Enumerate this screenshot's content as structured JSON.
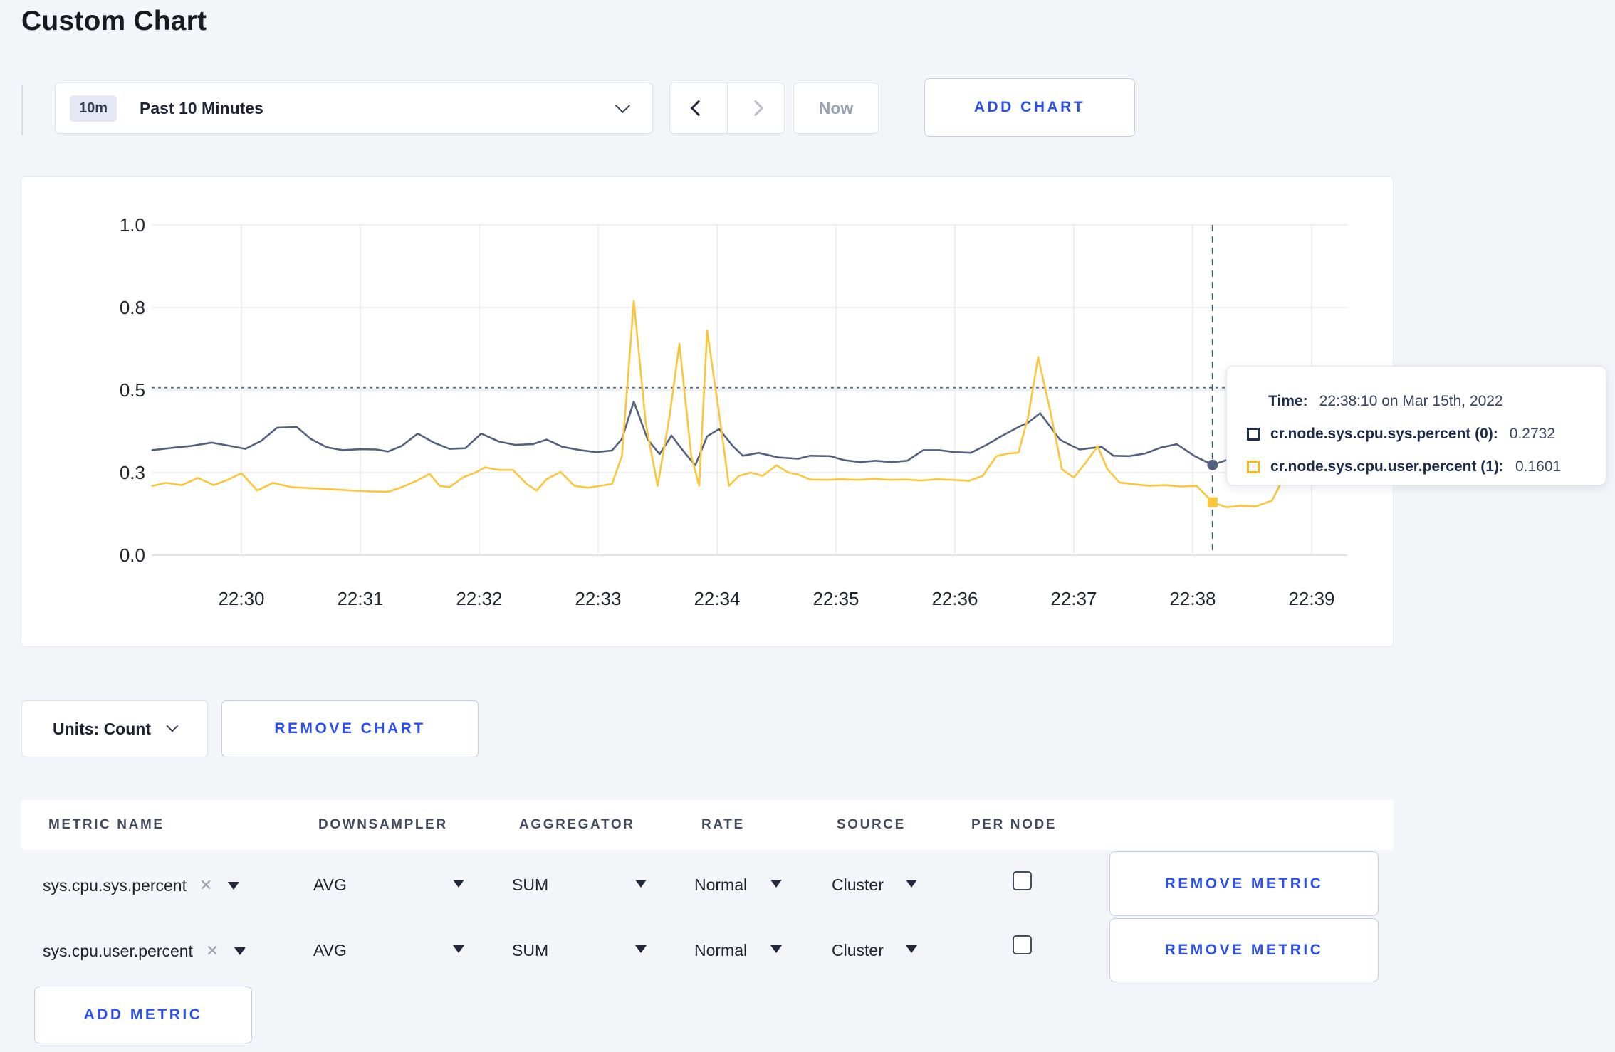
{
  "page": {
    "title": "Custom Chart",
    "background": "#f4f5f9",
    "accent_blue": "#2b4ff0"
  },
  "toolbar": {
    "time_badge": "10m",
    "time_label": "Past 10 Minutes",
    "now_label": "Now",
    "add_chart_label": "ADD CHART"
  },
  "chart_data": {
    "type": "line",
    "title": "",
    "xlabel": "",
    "ylabel": "",
    "x_domain_note": "t = seconds after 22:29:00, Mar 15th 2022",
    "ylim": [
      0,
      1
    ],
    "grid": true,
    "legend_position": "none",
    "x_ticks": [
      {
        "t": 60,
        "label": "22:30"
      },
      {
        "t": 120,
        "label": "22:31"
      },
      {
        "t": 180,
        "label": "22:32"
      },
      {
        "t": 240,
        "label": "22:33"
      },
      {
        "t": 300,
        "label": "22:34"
      },
      {
        "t": 360,
        "label": "22:35"
      },
      {
        "t": 420,
        "label": "22:36"
      },
      {
        "t": 480,
        "label": "22:37"
      },
      {
        "t": 540,
        "label": "22:38"
      },
      {
        "t": 600,
        "label": "22:39"
      }
    ],
    "y_ticks": [
      {
        "v": 0,
        "label": "0.0"
      },
      {
        "v": 0.25,
        "label": "0.3"
      },
      {
        "v": 0.5,
        "label": "0.5"
      },
      {
        "v": 0.75,
        "label": "0.8"
      },
      {
        "v": 1,
        "label": "1.0"
      }
    ],
    "series": [
      {
        "name": "cr.node.sys.cpu.sys.percent (0)",
        "color": "#54617e",
        "points": [
          [
            15,
            0.318
          ],
          [
            25,
            0.325
          ],
          [
            35,
            0.331
          ],
          [
            45,
            0.341
          ],
          [
            55,
            0.33
          ],
          [
            62,
            0.322
          ],
          [
            70,
            0.346
          ],
          [
            78,
            0.386
          ],
          [
            88,
            0.388
          ],
          [
            95,
            0.352
          ],
          [
            103,
            0.327
          ],
          [
            111,
            0.318
          ],
          [
            120,
            0.321
          ],
          [
            128,
            0.32
          ],
          [
            134,
            0.314
          ],
          [
            141,
            0.331
          ],
          [
            149,
            0.368
          ],
          [
            157,
            0.341
          ],
          [
            165,
            0.322
          ],
          [
            173,
            0.324
          ],
          [
            181,
            0.368
          ],
          [
            190,
            0.344
          ],
          [
            198,
            0.334
          ],
          [
            207,
            0.336
          ],
          [
            214,
            0.35
          ],
          [
            222,
            0.328
          ],
          [
            231,
            0.318
          ],
          [
            239,
            0.312
          ],
          [
            247,
            0.317
          ],
          [
            252,
            0.352
          ],
          [
            258,
            0.465
          ],
          [
            265,
            0.35
          ],
          [
            271,
            0.306
          ],
          [
            277,
            0.362
          ],
          [
            283,
            0.315
          ],
          [
            289,
            0.272
          ],
          [
            295,
            0.36
          ],
          [
            301,
            0.382
          ],
          [
            308,
            0.33
          ],
          [
            313,
            0.301
          ],
          [
            321,
            0.31
          ],
          [
            331,
            0.296
          ],
          [
            341,
            0.292
          ],
          [
            347,
            0.301
          ],
          [
            357,
            0.3
          ],
          [
            364,
            0.288
          ],
          [
            372,
            0.282
          ],
          [
            380,
            0.286
          ],
          [
            388,
            0.282
          ],
          [
            396,
            0.286
          ],
          [
            404,
            0.318
          ],
          [
            412,
            0.318
          ],
          [
            420,
            0.312
          ],
          [
            428,
            0.31
          ],
          [
            436,
            0.334
          ],
          [
            444,
            0.362
          ],
          [
            452,
            0.388
          ],
          [
            457,
            0.402
          ],
          [
            463,
            0.43
          ],
          [
            468,
            0.39
          ],
          [
            473,
            0.35
          ],
          [
            478,
            0.334
          ],
          [
            483,
            0.32
          ],
          [
            488,
            0.324
          ],
          [
            494,
            0.328
          ],
          [
            500,
            0.301
          ],
          [
            508,
            0.3
          ],
          [
            516,
            0.308
          ],
          [
            524,
            0.326
          ],
          [
            532,
            0.336
          ],
          [
            541,
            0.3
          ],
          [
            550,
            0.2732
          ],
          [
            558,
            0.29
          ],
          [
            566,
            0.286
          ],
          [
            575,
            0.281
          ],
          [
            584,
            0.283
          ],
          [
            593,
            0.286
          ],
          [
            602,
            0.281
          ],
          [
            611,
            0.286
          ]
        ]
      },
      {
        "name": "cr.node.sys.cpu.user.percent (1)",
        "color": "#fcc63c",
        "points": [
          [
            15,
            0.21
          ],
          [
            22,
            0.219
          ],
          [
            30,
            0.212
          ],
          [
            38,
            0.234
          ],
          [
            46,
            0.212
          ],
          [
            53,
            0.228
          ],
          [
            60,
            0.248
          ],
          [
            68,
            0.196
          ],
          [
            76,
            0.219
          ],
          [
            85,
            0.206
          ],
          [
            95,
            0.203
          ],
          [
            105,
            0.2
          ],
          [
            115,
            0.196
          ],
          [
            125,
            0.193
          ],
          [
            134,
            0.192
          ],
          [
            141,
            0.206
          ],
          [
            148,
            0.224
          ],
          [
            155,
            0.246
          ],
          [
            160,
            0.21
          ],
          [
            165,
            0.206
          ],
          [
            172,
            0.236
          ],
          [
            178,
            0.25
          ],
          [
            183,
            0.266
          ],
          [
            190,
            0.258
          ],
          [
            197,
            0.258
          ],
          [
            204,
            0.215
          ],
          [
            209,
            0.196
          ],
          [
            214,
            0.23
          ],
          [
            221,
            0.252
          ],
          [
            228,
            0.21
          ],
          [
            235,
            0.204
          ],
          [
            241,
            0.21
          ],
          [
            247,
            0.216
          ],
          [
            252,
            0.3
          ],
          [
            258,
            0.77
          ],
          [
            264,
            0.4
          ],
          [
            270,
            0.21
          ],
          [
            276,
            0.42
          ],
          [
            281,
            0.64
          ],
          [
            287,
            0.3
          ],
          [
            291,
            0.21
          ],
          [
            295,
            0.68
          ],
          [
            301,
            0.43
          ],
          [
            306,
            0.21
          ],
          [
            311,
            0.24
          ],
          [
            317,
            0.25
          ],
          [
            323,
            0.24
          ],
          [
            330,
            0.272
          ],
          [
            336,
            0.25
          ],
          [
            341,
            0.244
          ],
          [
            347,
            0.229
          ],
          [
            355,
            0.228
          ],
          [
            363,
            0.23
          ],
          [
            371,
            0.228
          ],
          [
            379,
            0.231
          ],
          [
            387,
            0.228
          ],
          [
            395,
            0.229
          ],
          [
            403,
            0.226
          ],
          [
            411,
            0.23
          ],
          [
            419,
            0.228
          ],
          [
            427,
            0.225
          ],
          [
            434,
            0.24
          ],
          [
            441,
            0.3
          ],
          [
            447,
            0.308
          ],
          [
            452,
            0.31
          ],
          [
            457,
            0.42
          ],
          [
            462,
            0.6
          ],
          [
            468,
            0.44
          ],
          [
            474,
            0.26
          ],
          [
            480,
            0.235
          ],
          [
            486,
            0.28
          ],
          [
            492,
            0.33
          ],
          [
            497,
            0.26
          ],
          [
            503,
            0.22
          ],
          [
            510,
            0.215
          ],
          [
            518,
            0.21
          ],
          [
            526,
            0.212
          ],
          [
            534,
            0.208
          ],
          [
            542,
            0.21
          ],
          [
            550,
            0.1601
          ],
          [
            557,
            0.145
          ],
          [
            564,
            0.15
          ],
          [
            572,
            0.148
          ],
          [
            580,
            0.165
          ],
          [
            588,
            0.26
          ],
          [
            594,
            0.272
          ],
          [
            600,
            0.24
          ],
          [
            606,
            0.215
          ],
          [
            612,
            0.275
          ]
        ]
      }
    ],
    "crosshair": {
      "t": 550,
      "h_value": 0.507,
      "markers": [
        {
          "series": 0,
          "v": 0.2732,
          "shape": "circle"
        },
        {
          "series": 1,
          "v": 0.1601,
          "shape": "square"
        }
      ]
    }
  },
  "tooltip": {
    "time_label": "Time:",
    "time_value": "22:38:10 on Mar 15th, 2022",
    "rows": [
      {
        "name": "cr.node.sys.cpu.sys.percent (0):",
        "value": "0.2732",
        "swatch_color": "#1d2c4c"
      },
      {
        "name": "cr.node.sys.cpu.user.percent (1):",
        "value": "0.1601",
        "swatch_color": "#f7b821"
      }
    ]
  },
  "units_row": {
    "units_label": "Units: Count",
    "remove_chart_label": "REMOVE CHART"
  },
  "table": {
    "headers": [
      "METRIC NAME",
      "DOWNSAMPLER",
      "AGGREGATOR",
      "RATE",
      "SOURCE",
      "PER NODE"
    ],
    "rows": [
      {
        "metric": "sys.cpu.sys.percent",
        "remove_icon": "✕",
        "downsampler": "AVG",
        "aggregator": "SUM",
        "rate": "Normal",
        "source": "Cluster",
        "per_node_checked": false,
        "remove_label": "REMOVE METRIC"
      },
      {
        "metric": "sys.cpu.user.percent",
        "remove_icon": "✕",
        "downsampler": "AVG",
        "aggregator": "SUM",
        "rate": "Normal",
        "source": "Cluster",
        "per_node_checked": false,
        "remove_label": "REMOVE METRIC"
      }
    ],
    "add_metric_label": "ADD METRIC"
  }
}
